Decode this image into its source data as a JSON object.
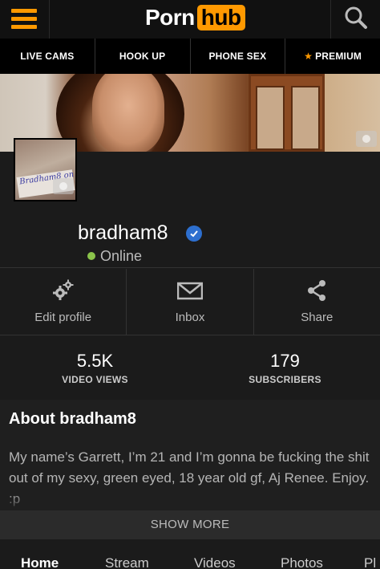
{
  "header": {
    "logo_word": "Porn",
    "logo_box": "hub",
    "menu_icon": "hamburger-menu-icon",
    "search_icon": "search-icon",
    "accent_color": "#ff9900"
  },
  "nav": {
    "items": [
      "LIVE CAMS",
      "HOOK UP",
      "PHONE SEX",
      "PREMIUM"
    ],
    "premium_star": "★"
  },
  "profile": {
    "username": "bradham8",
    "verified": true,
    "status": "Online",
    "status_color": "#8ac34a",
    "avatar_text": "Bradham8 on pornhub"
  },
  "actions": [
    {
      "label": "Edit profile",
      "icon": "gears-icon"
    },
    {
      "label": "Inbox",
      "icon": "envelope-icon"
    },
    {
      "label": "Share",
      "icon": "share-icon"
    }
  ],
  "stats": [
    {
      "value": "5.5K",
      "label": "VIDEO VIEWS"
    },
    {
      "value": "179",
      "label": "SUBSCRIBERS"
    }
  ],
  "about": {
    "title": "About bradham8",
    "text": "My name’s Garrett, I’m 21 and I’m gonna be fucking the shit out of my sexy, green eyed, 18 year old gf, Aj Renee. Enjoy. :p"
  },
  "show_more": "SHOW MORE",
  "tabs": [
    "Home",
    "Stream",
    "Videos",
    "Photos",
    "Pl"
  ]
}
